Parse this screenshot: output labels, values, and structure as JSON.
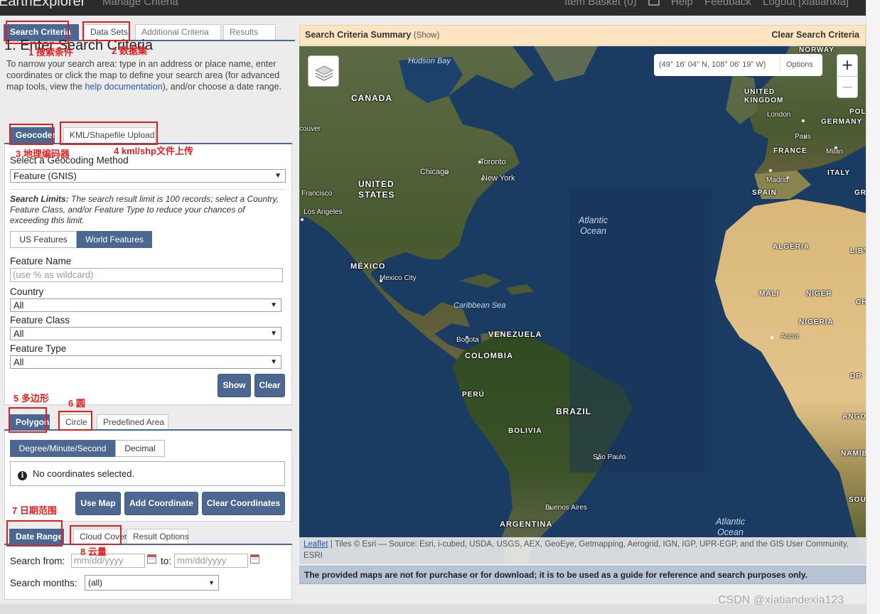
{
  "navbar": {
    "brand": "EarthExplorer",
    "manage": "Manage Criteria",
    "item_basket": "Item Basket (0)",
    "help": "Help",
    "feedback": "Feedback",
    "logout": "Logout [xiatianxia]"
  },
  "main_tabs": [
    "Search Criteria",
    "Data Sets",
    "Additional Criteria",
    "Results"
  ],
  "section_title": "1. Enter Search Criteria",
  "intro": {
    "before": "To narrow your search area: type in an address or place name, enter coordinates or click the map to define your search area (for advanced map tools, view the ",
    "link": "help documentation",
    "after": "), and/or choose a date range."
  },
  "geo_tabs": [
    "Geocoder",
    "KML/Shapefile Upload"
  ],
  "geocoder": {
    "method_label": "Select a Geocoding Method",
    "method_value": "Feature (GNIS)",
    "limits_bold": "Search Limits:",
    "limits_text": " The search result limit is 100 records; select a Country, Feature Class, and/or Feature Type to reduce your chances of exceeding this limit.",
    "toggles": [
      "US Features",
      "World Features"
    ],
    "feature_name_label": "Feature Name",
    "feature_name_placeholder": "(use % as wildcard)",
    "country_label": "Country",
    "country_value": "All",
    "class_label": "Feature Class",
    "class_value": "All",
    "type_label": "Feature Type",
    "type_value": "All",
    "show_button": "Show",
    "clear_button": "Clear"
  },
  "area_tabs": [
    "Polygon",
    "Circle",
    "Predefined Area"
  ],
  "polygon": {
    "toggles": [
      "Degree/Minute/Second",
      "Decimal"
    ],
    "no_coords": "No coordinates selected.",
    "use_map": "Use Map",
    "add_coordinate": "Add Coordinate",
    "clear_coordinates": "Clear Coordinates"
  },
  "date_tabs": [
    "Date Range",
    "Cloud Cover",
    "Result Options"
  ],
  "date": {
    "from_label": "Search from:",
    "from_placeholder": "mm/dd/yyyy",
    "to_label": "to:",
    "to_placeholder": "mm/dd/yyyy",
    "months_label": "Search months:",
    "months_value": "(all)"
  },
  "annotations": [
    "1 搜索条件",
    "2 数据集",
    "3 地理编码器",
    "4 kml/shp文件上传",
    "5 多边形",
    "6 圆",
    "7 日期范围",
    "8 云量"
  ],
  "map": {
    "summary_title": "Search Criteria Summary",
    "summary_show": "(Show)",
    "clear_criteria": "Clear Search Criteria",
    "coordinates": "(49° 16' 04\" N, 108° 06' 19\" W)",
    "options": "Options",
    "zoom_in": "+",
    "zoom_out": "−",
    "attribution_link": "Leaflet",
    "attribution_text": " | Tiles © Esri — Source: Esri, i-cubed, USDA, USGS, AEX, GeoEye, Getmapping, Aerogrid, IGN, IGP, UPR-EGP, and the GIS User Community, ESRI",
    "labels": {
      "hudson_bay": "Hudson Bay",
      "canada": "CANADA",
      "norway": "NORWAY",
      "united_kingdom": "UNITED\nKINGDOM",
      "london": "London",
      "germany": "GERMANY",
      "pola": "POLA",
      "paris": "Paris",
      "france": "FRANCE",
      "milan": "Milan",
      "madrid": "Madrid",
      "italy": "ITALY",
      "spain": "SPAIN",
      "gr": "GR",
      "couver": "couver",
      "toronto": "Toronto",
      "chicago": "Chicago",
      "new_york": "New York",
      "united_states": "UNITED\nSTATES",
      "francisco": "Francisco",
      "los_angeles": "Los Angeles",
      "atlantic_ocean": "Atlantic\nOcean",
      "algeria": "ALGERIA",
      "libya": "LIBYA",
      "mexico": "MÉXICO",
      "mexico_city": "Mexico City",
      "caribbean_sea": "Caribbean Sea",
      "mali": "MALI",
      "niger": "NIGER",
      "chad": "CHAD",
      "nigeria": "NIGERIA",
      "accra": "Accra",
      "bogota": "Bogota",
      "venezuela": "VENEZUELA",
      "colombia": "COLOMBIA",
      "dr": "DR",
      "peru": "PERÚ",
      "brazil": "BRAZIL",
      "bolivia": "BOLIVIA",
      "sao_paulo": "São Paulo",
      "angola": "ANGOLA",
      "namibia": "NAMIBIA",
      "buenos_aires": "Buenos Aires",
      "argentina": "ARGENTINA",
      "atlantic_ocean_south": "Atlantic\nOcean",
      "sou": "SOU"
    },
    "disclaimer": "The provided maps are not for purchase or for download; it is to be used as a guide for reference and search purposes only."
  },
  "watermark": "CSDN @xiatiandexia123",
  "colors": {
    "accent": "#4c6790",
    "annotation_red": "#e02020",
    "summary_bg": "#fce5c0",
    "ocean": "#1a3b62",
    "land": "#4a5a34"
  }
}
